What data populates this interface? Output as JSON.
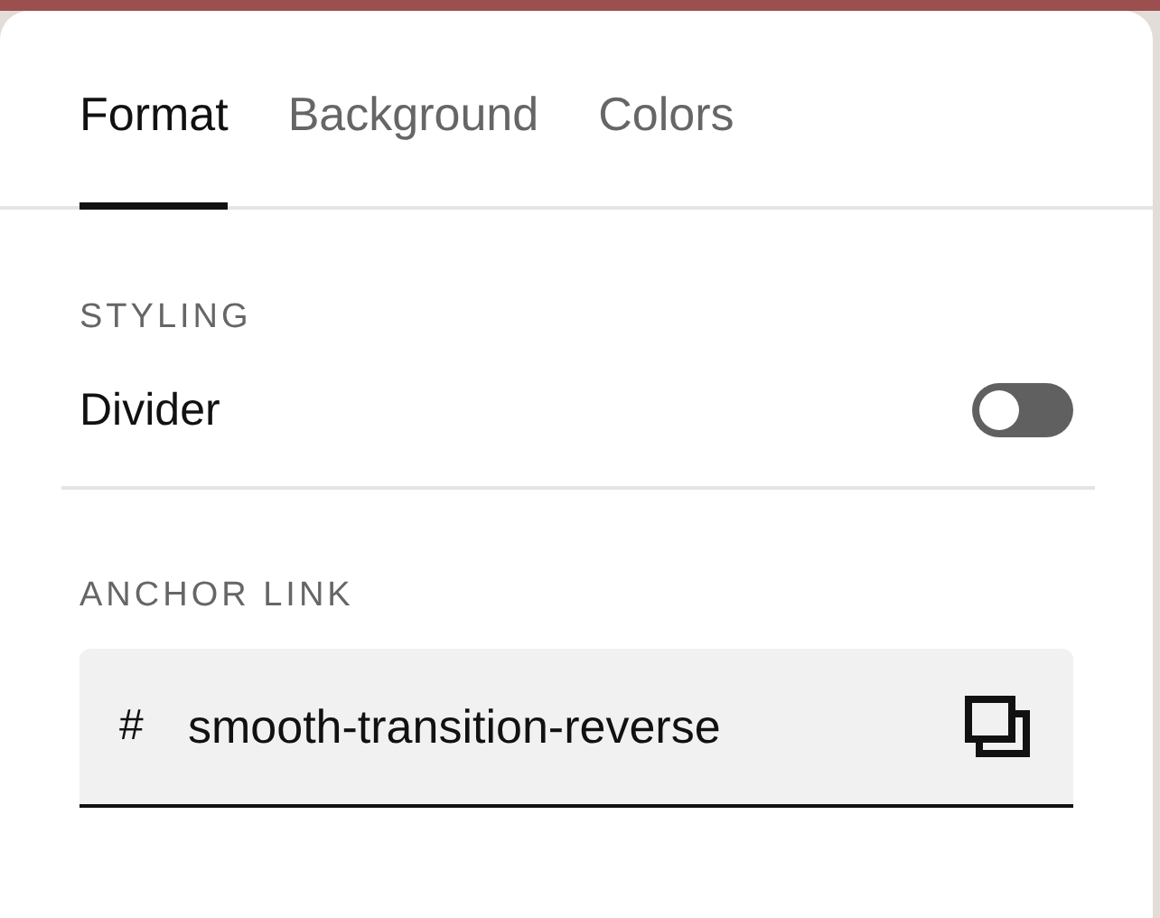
{
  "tabs": [
    {
      "label": "Format",
      "selected": true
    },
    {
      "label": "Background",
      "selected": false
    },
    {
      "label": "Colors",
      "selected": false
    }
  ],
  "styling": {
    "heading": "STYLING",
    "divider_toggle": {
      "label": "Divider",
      "on": false
    }
  },
  "anchor_link": {
    "heading": "ANCHOR LINK",
    "prefix": "#",
    "value": "smooth-transition-reverse"
  }
}
